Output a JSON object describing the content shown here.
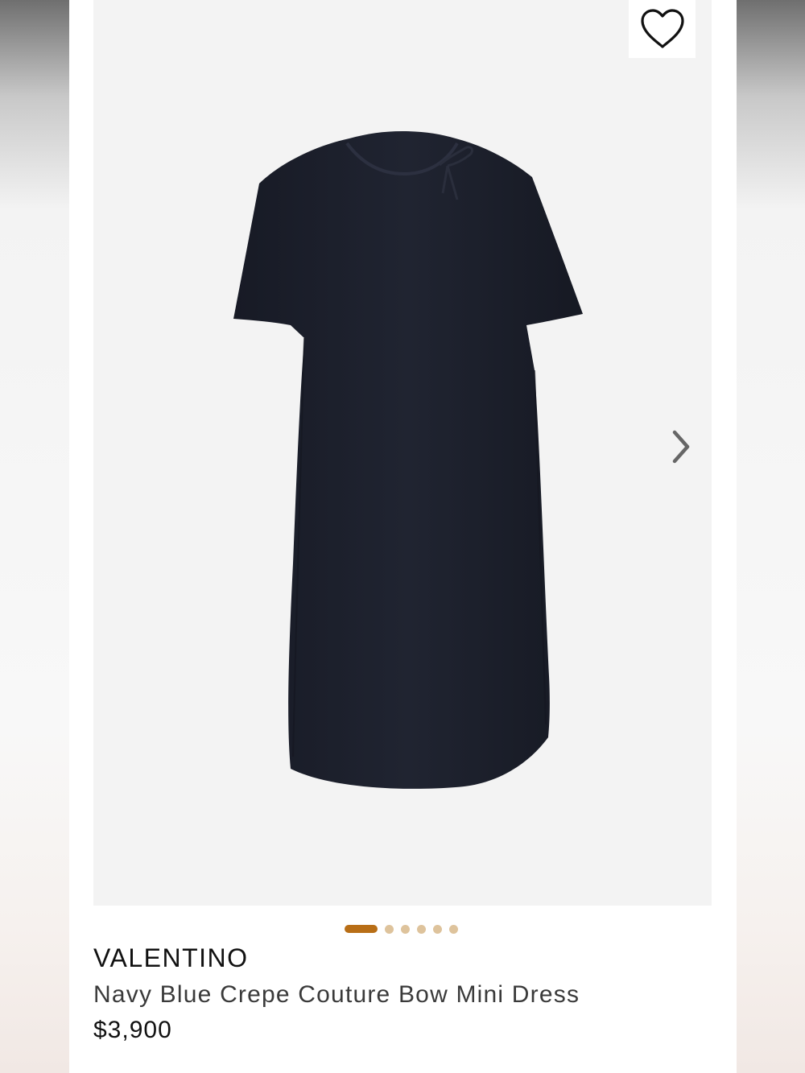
{
  "product": {
    "brand": "VALENTINO",
    "name": "Navy Blue Crepe Couture Bow Mini Dress",
    "price": "$3,900"
  },
  "gallery": {
    "image_count": 6,
    "active_index": 0,
    "next_icon": "chevron-right-icon",
    "favorite_icon": "heart-outline-icon"
  },
  "colors": {
    "dress": "#1c1f2b",
    "active_dot": "#b86e16",
    "inactive_dot": "#dec39c",
    "image_background": "#f3f3f3"
  }
}
